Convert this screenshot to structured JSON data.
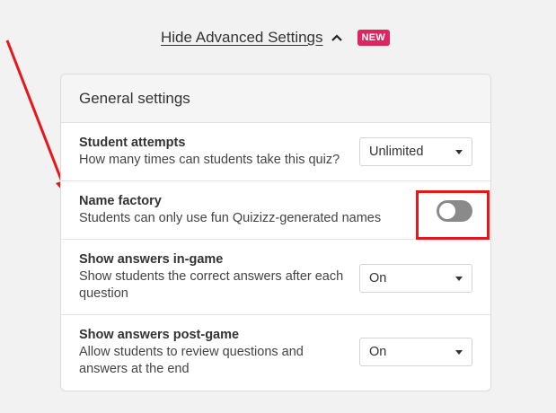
{
  "advanced": {
    "toggle_label": "Hide Advanced Settings",
    "new_badge": "NEW"
  },
  "general": {
    "title": "General settings",
    "rows": [
      {
        "title": "Student attempts",
        "desc": [
          "How many times can students take this quiz?"
        ],
        "control": "select",
        "value": "Unlimited"
      },
      {
        "title": "Name factory",
        "desc": [
          "Students can only use fun Quizizz-generated names"
        ],
        "control": "toggle",
        "checked": false
      },
      {
        "title": "Show answers in-game",
        "desc": [
          "Show students the correct answers after each",
          "question"
        ],
        "control": "select",
        "value": "On"
      },
      {
        "title": "Show answers post-game",
        "desc": [
          "Allow students to review questions and",
          "answers at the end"
        ],
        "control": "select",
        "value": "On"
      }
    ]
  },
  "annotation": {
    "color": "#e8161b"
  }
}
